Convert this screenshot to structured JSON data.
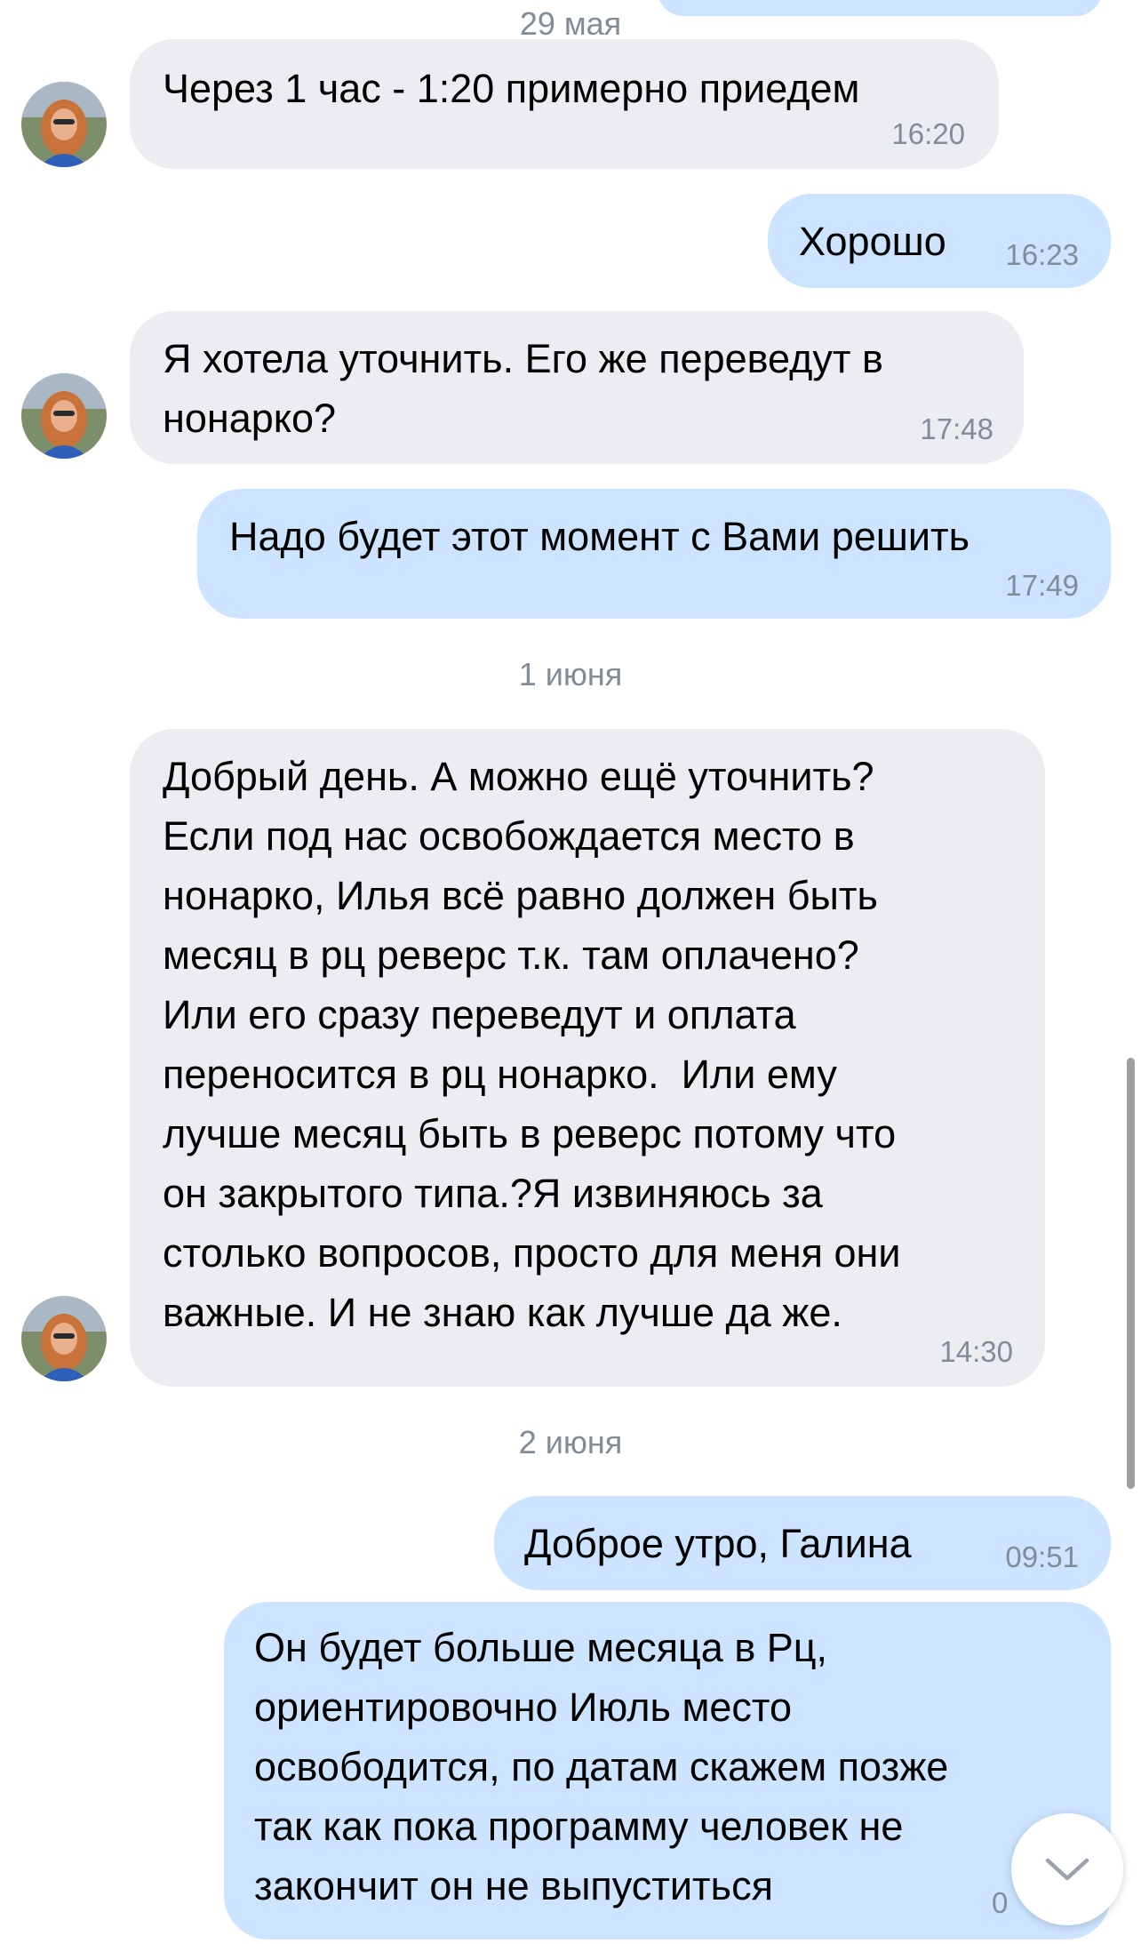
{
  "colors": {
    "incoming_bubble": "#ebedf0",
    "outgoing_bubble": "#cce4ff",
    "timestamp": "#818c99",
    "date_separator": "#818c99"
  },
  "icons": {
    "avatar": "avatar",
    "scroll_down": "chevron-down-icon"
  },
  "chat": {
    "dates": {
      "may29": "29 мая",
      "june1": "1 июня",
      "june2": "2 июня"
    },
    "messages": [
      {
        "direction": "in",
        "text": "Через 1 час - 1:20 примерно приедем",
        "time": "16:20"
      },
      {
        "direction": "out",
        "text": "Хорошо",
        "time": "16:23"
      },
      {
        "direction": "in",
        "text": "Я хотела уточнить. Его же переведут в\nнонарко?",
        "time": "17:48"
      },
      {
        "direction": "out",
        "text": "Надо будет этот момент с Вами решить",
        "time": "17:49"
      },
      {
        "direction": "in",
        "text": "Добрый день. А можно ещё уточнить?\nЕсли под нас освобождается место в\nнонарко, Илья всё равно должен быть\nмесяц в рц реверс т.к. там оплачено?\nИли его сразу переведут и оплата\nпереносится в рц нонарко.  Или ему\nлучше месяц быть в реверс потому что\nон закрытого типа.?Я извиняюсь за\nстолько вопросов, просто для меня они\nважные. И не знаю как лучше да же.",
        "time": "14:30"
      },
      {
        "direction": "out",
        "text": "Доброе утро, Галина",
        "time": "09:51"
      },
      {
        "direction": "out",
        "text": "Он будет больше месяца в Рц,\nориентировочно Июль место\nосвободится, по датам скажем позже\nтак как пока программу человек не\nзакончит он не выпуститься",
        "time": "0"
      }
    ]
  }
}
